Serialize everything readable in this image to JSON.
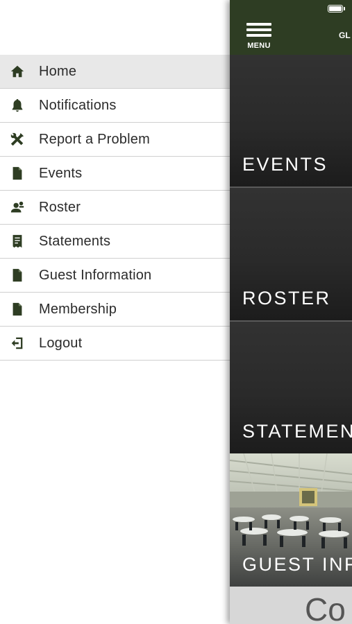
{
  "drawer": {
    "items": [
      {
        "label": "Home",
        "icon": "home-icon",
        "active": true
      },
      {
        "label": "Notifications",
        "icon": "bell-icon"
      },
      {
        "label": "Report a Problem",
        "icon": "tools-icon"
      },
      {
        "label": "Events",
        "icon": "document-icon"
      },
      {
        "label": "Roster",
        "icon": "person-icon"
      },
      {
        "label": "Statements",
        "icon": "receipt-icon"
      },
      {
        "label": "Guest Information",
        "icon": "document-icon"
      },
      {
        "label": "Membership",
        "icon": "document-icon"
      },
      {
        "label": "Logout",
        "icon": "logout-icon"
      }
    ]
  },
  "header": {
    "menu_label": "MENU",
    "title": "GL"
  },
  "tiles": [
    {
      "label": "EVENTS"
    },
    {
      "label": "ROSTER"
    },
    {
      "label": "STATEMEN"
    },
    {
      "label": "GUEST INF"
    }
  ],
  "bottom": {
    "text": "Co"
  },
  "colors": {
    "header_bg": "#2e3d23",
    "icon_color": "#2e3d23",
    "active_item_bg": "#e8e8e8"
  }
}
